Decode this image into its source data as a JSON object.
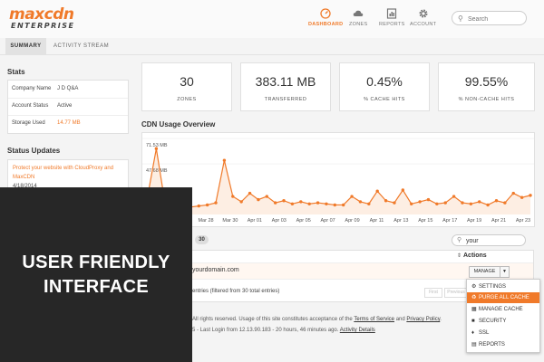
{
  "header": {
    "logo_top": "maxcdn",
    "logo_bottom": "ENTERPRISE",
    "nav": [
      {
        "label": "DASHBOARD",
        "icon": "dashboard-icon"
      },
      {
        "label": "ZONES",
        "icon": "cloud-icon"
      },
      {
        "label": "REPORTS",
        "icon": "reports-icon"
      },
      {
        "label": "ACCOUNT",
        "icon": "gear-icon"
      }
    ],
    "search_placeholder": "Search",
    "accent_color": "#f07a2a"
  },
  "tabs": [
    "SUMMARY",
    "ACTIVITY STREAM"
  ],
  "stats": {
    "title": "Stats",
    "rows": [
      {
        "key": "Company Name",
        "value": "J D Q&A"
      },
      {
        "key": "Account Status",
        "value": "Active"
      },
      {
        "key": "Storage Used",
        "value": "14.77 MB"
      }
    ]
  },
  "status_updates": {
    "title": "Status Updates",
    "link": "Protect your website with CloudProxy and MaxCDN",
    "date": "4/18/2014"
  },
  "kpis": [
    {
      "value": "30",
      "label": "ZONES"
    },
    {
      "value": "383.11 MB",
      "label": "TRANSFERRED"
    },
    {
      "value": "0.45%",
      "label": "% CACHE HITS"
    },
    {
      "value": "99.55%",
      "label": "% NON-CACHE HITS"
    }
  ],
  "chart_title": "CDN Usage Overview",
  "chart_data": {
    "type": "area",
    "yticks": [
      "71.53 MB",
      "47.68 MB"
    ],
    "ytick_values": [
      71.53,
      47.68
    ],
    "ylim": [
      0,
      75
    ],
    "x_labels": [
      "Mar 28",
      "Mar 30",
      "Apr 01",
      "Apr 03",
      "Apr 05",
      "Apr 07",
      "Apr 09",
      "Apr 11",
      "Apr 13",
      "Apr 15",
      "Apr 17",
      "Apr 19",
      "Apr 21",
      "Apr 23"
    ],
    "series": [
      {
        "color": "#f07a2a",
        "values": [
          18,
          62,
          12,
          9,
          10,
          7,
          8,
          9,
          11,
          51,
          17,
          12,
          20,
          14,
          17,
          11,
          13,
          10,
          12,
          10,
          11,
          10,
          9,
          9,
          17,
          12,
          10,
          22,
          13,
          11,
          23,
          10,
          12,
          14,
          10,
          11,
          17,
          11,
          10,
          12,
          9,
          13,
          11,
          20,
          16,
          18
        ]
      }
    ]
  },
  "table": {
    "count": "30",
    "search_value": "your",
    "actions_header": "Actions",
    "row_domain": "yourdomain.com",
    "manage_label": "MANAGE",
    "info": "entries (filtered from 30 total entries)",
    "pager": [
      "First",
      "Previous"
    ]
  },
  "dropdown": [
    {
      "label": "SETTINGS",
      "icon": "gear-icon"
    },
    {
      "label": "PURGE ALL CACHE",
      "icon": "trash-icon",
      "active": true
    },
    {
      "label": "MANAGE CACHE",
      "icon": "grid-icon"
    },
    {
      "label": "SECURITY",
      "icon": "lock-icon"
    },
    {
      "label": "SSL",
      "icon": "ssl-icon"
    },
    {
      "label": "REPORTS",
      "icon": "reports-icon"
    }
  ],
  "footer": {
    "line1_prefix": "All rights reserved. Usage of this site constitutes acceptance of the",
    "tos": "Terms of Service",
    "and": "and",
    "privacy": "Privacy Policy",
    "line2_prefix": "5 - Last Login from 12.13.90.183 - 20 hours, 46 minutes ago.",
    "activity": "Activity Details"
  },
  "overlay": {
    "line1": "USER FRIENDLY",
    "line2": "INTERFACE"
  }
}
